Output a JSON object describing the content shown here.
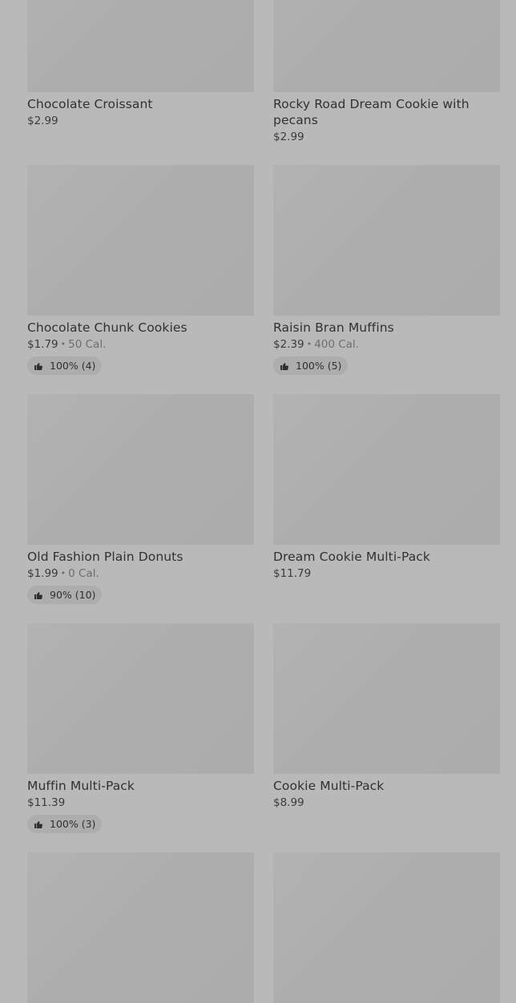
{
  "products": [
    {
      "name": "Chocolate Croissant",
      "price": "$2.99",
      "calories": "",
      "rating": ""
    },
    {
      "name": "Rocky Road Dream Cookie with pecans",
      "price": "$2.99",
      "calories": "",
      "rating": ""
    },
    {
      "name": "Chocolate Chunk Cookies",
      "price": "$1.79",
      "calories": "50 Cal.",
      "rating": "100% (4)"
    },
    {
      "name": "Raisin Bran Muffins",
      "price": "$2.39",
      "calories": "400 Cal.",
      "rating": "100% (5)"
    },
    {
      "name": "Old Fashion Plain Donuts",
      "price": "$1.99",
      "calories": "0 Cal.",
      "rating": "90% (10)"
    },
    {
      "name": "Dream Cookie Multi-Pack",
      "price": "$11.79",
      "calories": "",
      "rating": ""
    },
    {
      "name": "Muffin Multi-Pack",
      "price": "$11.39",
      "calories": "",
      "rating": "100% (3)"
    },
    {
      "name": "Cookie Multi-Pack",
      "price": "$8.99",
      "calories": "",
      "rating": ""
    }
  ],
  "icons": {
    "rating": "thumbs-up-icon"
  },
  "colors": {
    "background": "#b9b9b9",
    "image_placeholder": "#afafaf",
    "rating_pill": "#adadad",
    "text_primary": "#313131",
    "text_secondary": "#6d6d6d"
  }
}
